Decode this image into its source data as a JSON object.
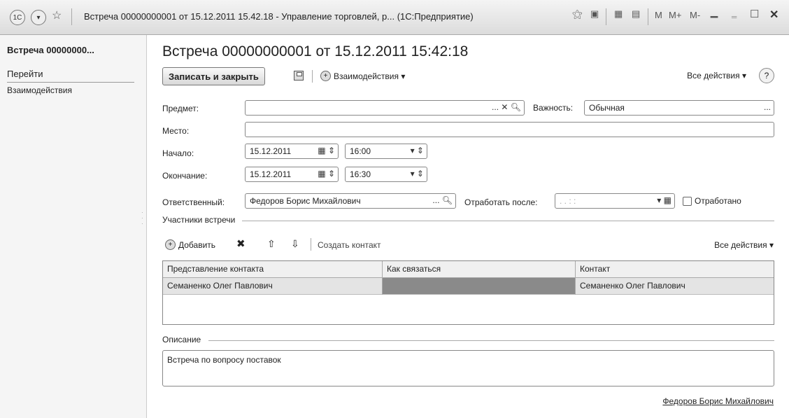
{
  "window": {
    "title": "Встреча 00000000001 от 15.12.2011 15.42.18 - Управление торговлей, р... (1С:Предприятие)",
    "logo": "1C",
    "controls": [
      "M",
      "M+",
      "M-"
    ]
  },
  "left_panel": {
    "title": "Встреча 00000000...",
    "goto_label": "Перейти",
    "link": "Взаимодействия"
  },
  "form": {
    "title": "Встреча 00000000001 от 15.12.2011 15:42:18",
    "toolbar": {
      "save_close": "Записать и закрыть",
      "interactions": "Взаимодействия ▾",
      "all_actions": "Все действия ▾",
      "help": "?"
    },
    "subject": {
      "label": "Предмет:",
      "value": ""
    },
    "importance": {
      "label": "Важность:",
      "value": "Обычная"
    },
    "place": {
      "label": "Место:",
      "value": ""
    },
    "start": {
      "label": "Начало:",
      "date": "15.12.2011",
      "time": "16:00"
    },
    "end": {
      "label": "Окончание:",
      "date": "15.12.2011",
      "time": "16:30"
    },
    "responsible": {
      "label": "Ответственный:",
      "value": "Федоров Борис Михайлович"
    },
    "work_after": {
      "label": "Отработать после:",
      "value": "  .  .      :  :"
    },
    "worked": {
      "label": "Отработано",
      "checked": false
    },
    "participants": {
      "group_label": "Участники встречи",
      "add": "Добавить",
      "create_contact": "Создать контакт",
      "all_actions": "Все действия ▾",
      "columns": [
        "Представление контакта",
        "Как связаться",
        "Контакт"
      ],
      "rows": [
        [
          "Семаненко Олег Павлович",
          "",
          "Семаненко Олег Павлович"
        ]
      ]
    },
    "description": {
      "group_label": "Описание",
      "value": "Встреча по вопросу поставок"
    },
    "author": "Федоров Борис Михайлович"
  }
}
